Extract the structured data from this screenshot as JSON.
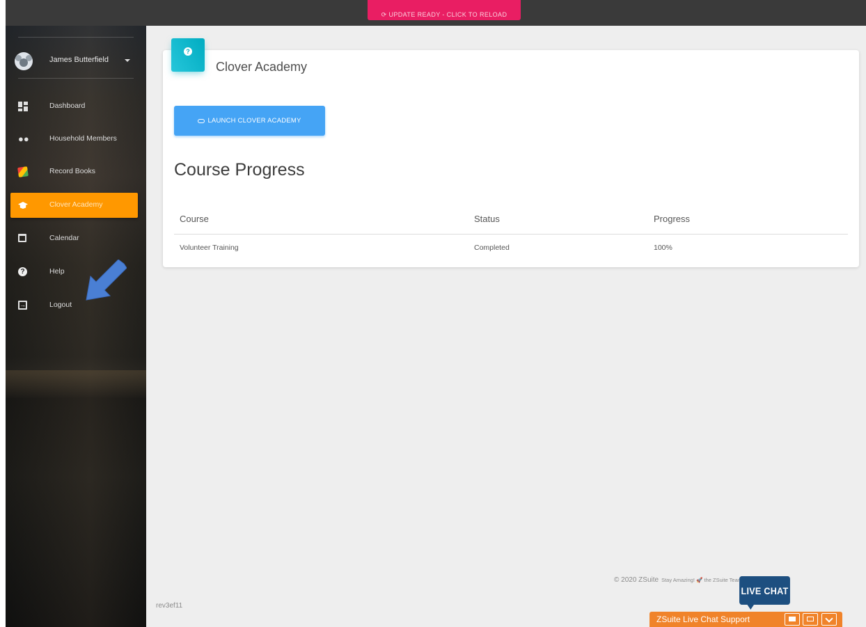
{
  "topbar": {
    "update_label": "⟳ UPDATE READY - CLICK TO RELOAD"
  },
  "sidebar": {
    "user_name": "James Butterfield",
    "items": [
      {
        "label": "Dashboard",
        "icon": "dashboard-icon"
      },
      {
        "label": "Household Members",
        "icon": "people-icon"
      },
      {
        "label": "Record Books",
        "icon": "record-book-icon"
      },
      {
        "label": "Clover Academy",
        "icon": "graduation-cap-icon",
        "active": true
      },
      {
        "label": "Calendar",
        "icon": "calendar-icon"
      },
      {
        "label": "Help",
        "icon": "help-icon"
      },
      {
        "label": "Logout",
        "icon": "logout-icon"
      }
    ],
    "active_color": "#ff9800"
  },
  "card": {
    "title": "Clover Academy",
    "launch_button": "LAUNCH CLOVER ACADEMY",
    "section_title": "Course Progress",
    "table": {
      "headers": [
        "Course",
        "Status",
        "Progress"
      ],
      "rows": [
        [
          "Volunteer Training",
          "Completed",
          "100%"
        ]
      ]
    }
  },
  "footer": {
    "revision": "rev3ef11",
    "copyright": "© 2020 ZSuite",
    "tagline": "Stay Amazing! 🚀 the ZSuite Team"
  },
  "chat": {
    "bubble": "LIVE CHAT",
    "bar_label": "ZSuite Live Chat Support"
  },
  "colors": {
    "accent": "#00acc1",
    "button": "#45a4f5",
    "update": "#e91e63",
    "chat": "#f0832a",
    "chat_bubble": "#1d4f80"
  }
}
